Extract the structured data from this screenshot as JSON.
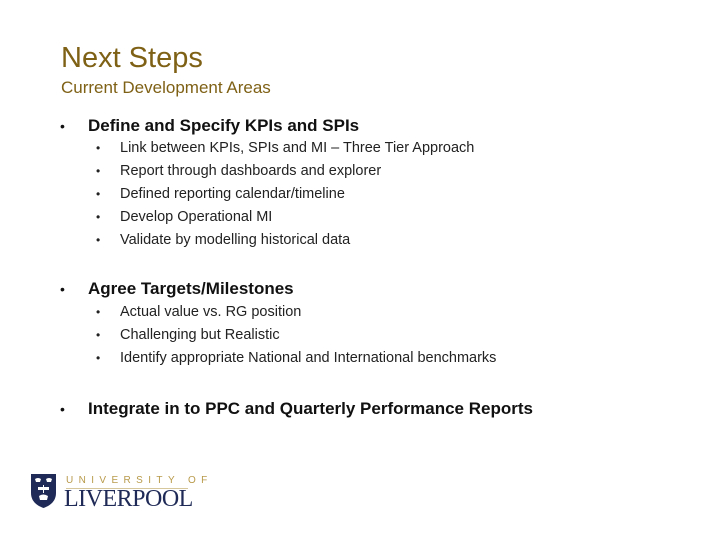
{
  "slide": {
    "title": "Next Steps",
    "subtitle": "Current Development Areas",
    "bullet_glyph": "•",
    "sections": [
      {
        "heading": "Define and Specify KPIs and SPIs",
        "items": [
          "Link between KPIs, SPIs and MI – Three Tier Approach",
          "Report through dashboards and explorer",
          "Defined reporting calendar/timeline",
          "Develop Operational MI",
          "Validate by modelling historical data"
        ]
      },
      {
        "heading": "Agree Targets/Milestones",
        "items": [
          "Actual value vs. RG position",
          "Challenging but Realistic",
          "Identify appropriate National and International benchmarks"
        ]
      },
      {
        "heading": "Integrate in to PPC and Quarterly Performance Reports",
        "items": []
      }
    ]
  },
  "logo": {
    "line1": "UNIVERSITY OF",
    "line2": "LIVERPOOL"
  },
  "colors": {
    "title": "#7f6116",
    "logo_navy": "#1f2a56",
    "logo_gold": "#b89a4a"
  }
}
